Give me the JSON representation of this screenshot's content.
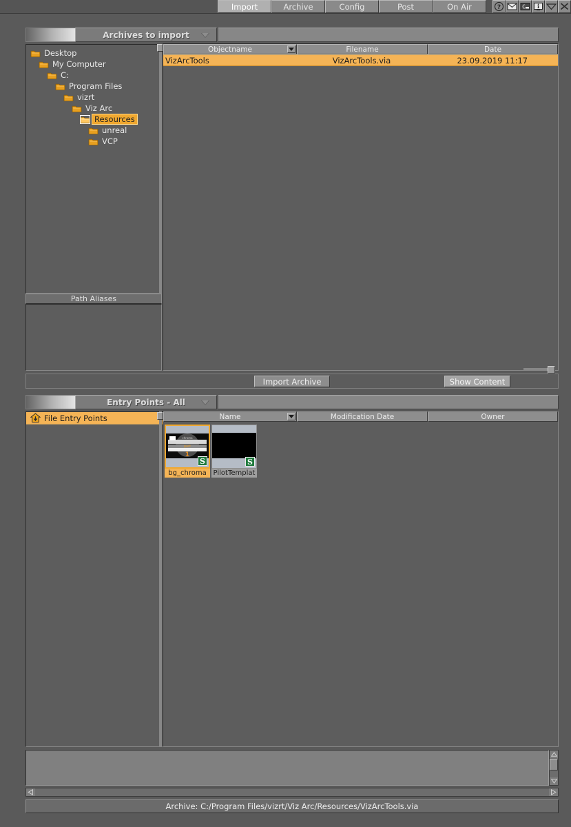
{
  "window": {
    "tabs": [
      {
        "label": "Import",
        "active": true
      },
      {
        "label": "Archive",
        "active": false
      },
      {
        "label": "Config",
        "active": false
      },
      {
        "label": "Post",
        "active": false
      },
      {
        "label": "On Air",
        "active": false
      }
    ],
    "icon_buttons": [
      {
        "name": "help-icon",
        "glyph": "?"
      },
      {
        "name": "mail-icon",
        "glyph": "envelope"
      },
      {
        "name": "console-icon",
        "glyph": "C"
      },
      {
        "name": "info-icon",
        "glyph": "i"
      },
      {
        "name": "chevron-down-icon",
        "glyph": "v"
      },
      {
        "name": "close-icon",
        "glyph": "x"
      }
    ]
  },
  "archives_section": {
    "title": "Archives to import",
    "tree": [
      {
        "label": "Desktop",
        "depth": 0,
        "selected": false
      },
      {
        "label": "My Computer",
        "depth": 1,
        "selected": false
      },
      {
        "label": "C:",
        "depth": 2,
        "selected": false
      },
      {
        "label": "Program Files",
        "depth": 3,
        "selected": false
      },
      {
        "label": "vizrt",
        "depth": 4,
        "selected": false
      },
      {
        "label": "Viz Arc",
        "depth": 5,
        "selected": false
      },
      {
        "label": "Resources",
        "depth": 6,
        "selected": true
      },
      {
        "label": "unreal",
        "depth": 7,
        "selected": false
      },
      {
        "label": "VCP",
        "depth": 7,
        "selected": false
      }
    ],
    "path_aliases_title": "Path Aliases",
    "table": {
      "columns": [
        "Objectname",
        "Filename",
        "Date"
      ],
      "rows": [
        {
          "objectname": "VizArcTools",
          "filename": "VizArcTools.via",
          "date": "23.09.2019 11:17",
          "selected": true
        }
      ]
    },
    "import_button": "Import Archive",
    "show_content_button": "Show Content"
  },
  "entry_points_section": {
    "title": "Entry Points - All",
    "left_items": [
      {
        "label": "File Entry Points",
        "selected": true,
        "icon": "home-down-icon"
      }
    ],
    "table": {
      "columns": [
        "Name",
        "Modification Date",
        "Owner"
      ]
    },
    "thumbnails": [
      {
        "name": "bg_chroma",
        "selected": true,
        "badge": "S",
        "preview": "chroma-bars"
      },
      {
        "name": "PilotTemplat",
        "selected": false,
        "badge": "S",
        "preview": "black"
      }
    ]
  },
  "status": {
    "text": "Archive: C:/Program Files/vizrt/Viz Arc/Resources/VizArcTools.via"
  },
  "colors": {
    "selection_orange": "#f5b456",
    "window_bg": "#5a5a5a",
    "panel_bg": "#5d5d5d",
    "header_gray": "#8e8e8e",
    "badge_green": "#1f7a3d"
  }
}
